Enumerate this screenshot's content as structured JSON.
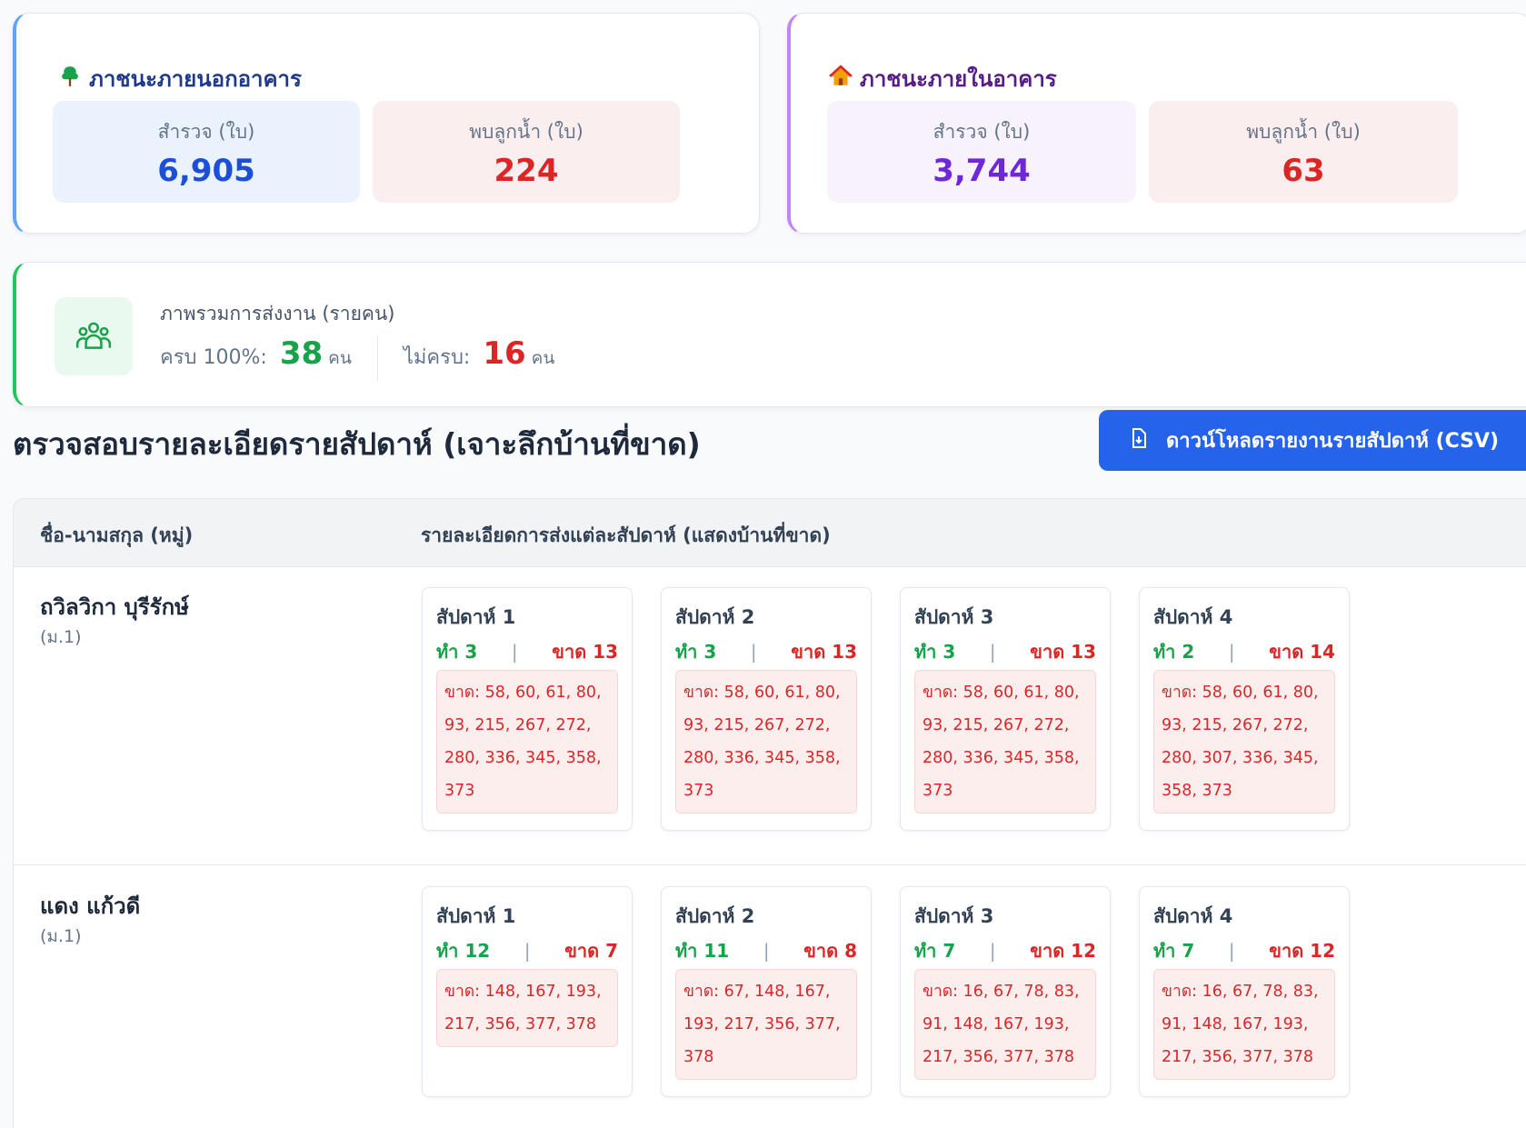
{
  "outdoor": {
    "title": "ภาชนะภายนอกอาคาร",
    "icon": "tree-icon",
    "surveyed_label": "สำรวจ (ใบ)",
    "surveyed_value": "6,905",
    "larvae_label": "พบลูกน้ำ (ใบ)",
    "larvae_value": "224"
  },
  "indoor": {
    "title": "ภาชนะภายในอาคาร",
    "icon": "house-icon",
    "surveyed_label": "สำรวจ (ใบ)",
    "surveyed_value": "3,744",
    "larvae_label": "พบลูกน้ำ (ใบ)",
    "larvae_value": "63"
  },
  "summary": {
    "title": "ภาพรวมการส่งงาน (รายคน)",
    "icon": "users-group-icon",
    "complete_label": "ครบ 100%:",
    "complete_value": "38",
    "incomplete_label": "ไม่ครบ:",
    "incomplete_value": "16",
    "unit": "คน"
  },
  "section": {
    "title": "ตรวจสอบรายละเอียดรายสัปดาห์ (เจาะลึกบ้านที่ขาด)",
    "download_label": "ดาวน์โหลดรายงานรายสัปดาห์ (CSV)"
  },
  "table": {
    "col_name": "ชื่อ-นามสกุล (หมู่)",
    "col_detail": "รายละเอียดการส่งแต่ละสัปดาห์ (แสดงบ้านที่ขาด)",
    "rows": [
      {
        "name": "ถวิลวิกา บุรีรักษ์",
        "village": "(ม.1)",
        "weeks": [
          {
            "title": "สัปดาห์ 1",
            "done": "ทำ 3",
            "missing": "ขาด 13",
            "list": "ขาด: 58, 60, 61, 80, 93, 215, 267, 272, 280, 336, 345, 358, 373"
          },
          {
            "title": "สัปดาห์ 2",
            "done": "ทำ 3",
            "missing": "ขาด 13",
            "list": "ขาด: 58, 60, 61, 80, 93, 215, 267, 272, 280, 336, 345, 358, 373"
          },
          {
            "title": "สัปดาห์ 3",
            "done": "ทำ 3",
            "missing": "ขาด 13",
            "list": "ขาด: 58, 60, 61, 80, 93, 215, 267, 272, 280, 336, 345, 358, 373"
          },
          {
            "title": "สัปดาห์ 4",
            "done": "ทำ 2",
            "missing": "ขาด 14",
            "list": "ขาด: 58, 60, 61, 80, 93, 215, 267, 272, 280, 307, 336, 345, 358, 373"
          }
        ]
      },
      {
        "name": "แดง แก้วดี",
        "village": "(ม.1)",
        "weeks": [
          {
            "title": "สัปดาห์ 1",
            "done": "ทำ 12",
            "missing": "ขาด 7",
            "list": "ขาด: 148, 167, 193, 217, 356, 377, 378"
          },
          {
            "title": "สัปดาห์ 2",
            "done": "ทำ 11",
            "missing": "ขาด 8",
            "list": "ขาด: 67, 148, 167, 193, 217, 356, 377, 378"
          },
          {
            "title": "สัปดาห์ 3",
            "done": "ทำ 7",
            "missing": "ขาด 12",
            "list": "ขาด: 16, 67, 78, 83, 91, 148, 167, 193, 217, 356, 377, 378"
          },
          {
            "title": "สัปดาห์ 4",
            "done": "ทำ 7",
            "missing": "ขาด 12",
            "list": "ขาด: 16, 67, 78, 83, 91, 148, 167, 193, 217, 356, 377, 378"
          }
        ]
      }
    ]
  }
}
